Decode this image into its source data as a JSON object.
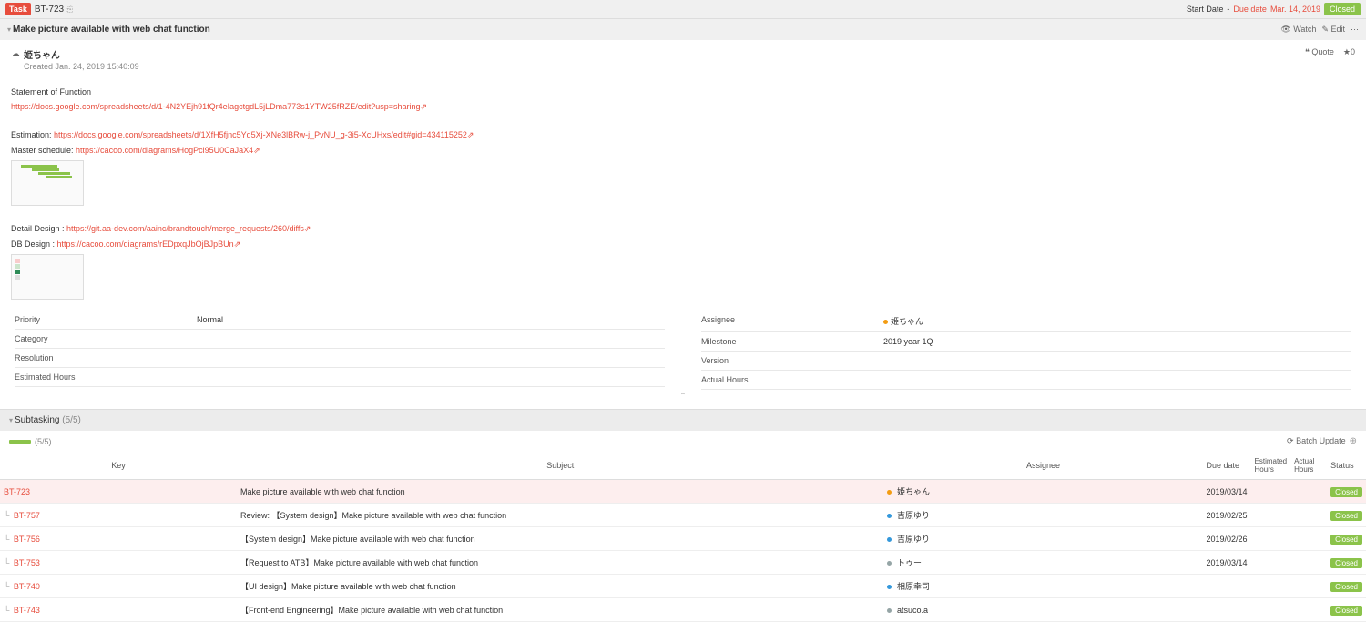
{
  "header": {
    "task_label": "Task",
    "issue_key": "BT-723",
    "start_date_label": "Start Date",
    "start_date_value": "-",
    "due_date_label": "Due date",
    "due_date_value": "Mar. 14, 2019",
    "status": "Closed"
  },
  "title": {
    "text": "Make picture available with web chat function",
    "watch": "Watch",
    "edit": "Edit"
  },
  "author": {
    "name": "姫ちゃん",
    "created": "Created Jan. 24, 2019 15:40:09",
    "quote": "Quote",
    "star": "★0"
  },
  "description": {
    "stmt_label": "Statement of Function",
    "stmt_link": "https://docs.google.com/spreadsheets/d/1-4N2YEjh91fQr4eIagctgdL5jLDma773s1YTW25fRZE/edit?usp=sharing",
    "est_label": "Estimation: ",
    "est_link": "https://docs.google.com/spreadsheets/d/1XfH5fjnc5Yd5Xj-XNe3lBRw-j_PvNU_g-3i5-XcUHxs/edit#gid=434115252",
    "sched_label": "Master schedule: ",
    "sched_link": "https://cacoo.com/diagrams/HogPci95U0CaJaX4",
    "detail_label": "Detail Design : ",
    "detail_link": "https://git.aa-dev.com/aainc/brandtouch/merge_requests/260/diffs",
    "db_label": "DB Design : ",
    "db_link": "https://cacoo.com/diagrams/rEDpxqJbOjBJpBUn"
  },
  "fields": {
    "priority_label": "Priority",
    "priority_val": "Normal",
    "category_label": "Category",
    "resolution_label": "Resolution",
    "est_hours_label": "Estimated Hours",
    "assignee_label": "Assignee",
    "assignee_val": "姫ちゃん",
    "milestone_label": "Milestone",
    "milestone_val": "2019 year 1Q",
    "version_label": "Version",
    "actual_hours_label": "Actual Hours"
  },
  "subtasking": {
    "label": "Subtasking",
    "count": "(5/5)",
    "progress": "(5/5)",
    "batch": "Batch Update",
    "cols": {
      "key": "Key",
      "subject": "Subject",
      "assignee": "Assignee",
      "due": "Due date",
      "est": "Estimated Hours",
      "act": "Actual Hours",
      "status": "Status"
    },
    "rows": [
      {
        "key": "BT-723",
        "subject": "Make picture available with web chat function",
        "assignee": "姫ちゃん",
        "dot": "dot-orange",
        "due": "2019/03/14",
        "status": "Closed",
        "current": true
      },
      {
        "key": "BT-757",
        "subject": "Review: 【System design】Make picture available with web chat function",
        "assignee": "吉原ゆり",
        "dot": "dot-blue",
        "due": "2019/02/25",
        "status": "Closed"
      },
      {
        "key": "BT-756",
        "subject": "【System design】Make picture available with web chat function",
        "assignee": "吉原ゆり",
        "dot": "dot-blue",
        "due": "2019/02/26",
        "status": "Closed"
      },
      {
        "key": "BT-753",
        "subject": "【Request to ATB】Make picture available with web chat function",
        "assignee": "トゥー",
        "dot": "dot-gray",
        "due": "2019/03/14",
        "status": "Closed"
      },
      {
        "key": "BT-740",
        "subject": "【UI design】Make picture available with web chat function",
        "assignee": "相原幸司",
        "dot": "dot-blue",
        "due": "",
        "status": "Closed"
      },
      {
        "key": "BT-743",
        "subject": "【Front-end Engineering】Make picture available with web chat function",
        "assignee": "atsuco.a",
        "dot": "dot-gray",
        "due": "",
        "status": "Closed"
      }
    ]
  }
}
